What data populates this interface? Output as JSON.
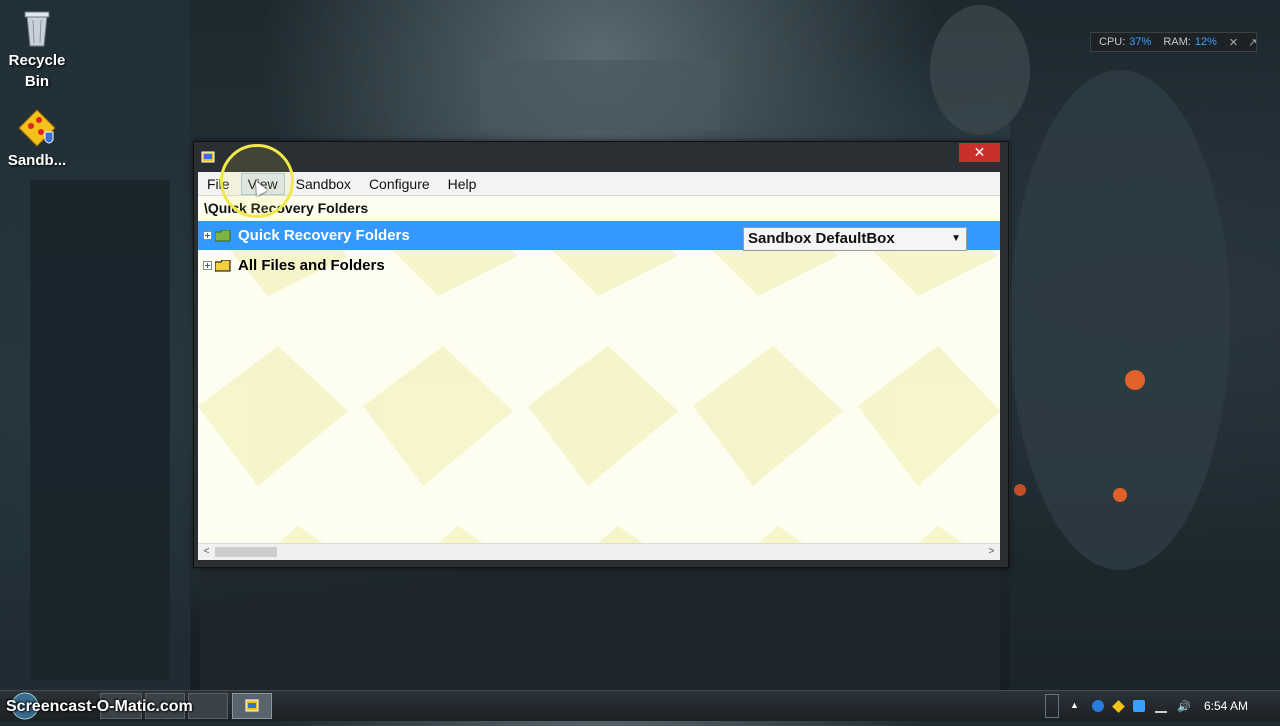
{
  "desktop": {
    "icons": [
      {
        "label": "Recycle Bin",
        "icon": "recycle-bin-icon"
      },
      {
        "label": "Sandb...",
        "icon": "sandboxie-icon"
      }
    ]
  },
  "sysmon": {
    "cpu_label": "CPU:",
    "cpu_value": "37%",
    "ram_label": "RAM:",
    "ram_value": "12%"
  },
  "window": {
    "title": "",
    "close_label": "✕",
    "menu": [
      {
        "label": "File"
      },
      {
        "label": "View"
      },
      {
        "label": "Sandbox"
      },
      {
        "label": "Configure"
      },
      {
        "label": "Help"
      }
    ],
    "path": "\\Quick Recovery Folders",
    "tree": [
      {
        "label": "Quick Recovery Folders",
        "selected": true
      },
      {
        "label": "All Files and Folders",
        "selected": false
      }
    ],
    "sandbox_select": {
      "value": "Sandbox DefaultBox",
      "options": [
        "Sandbox DefaultBox"
      ]
    },
    "scroll_left": "<",
    "scroll_right": ">"
  },
  "taskbar": {
    "watermark": "Screencast-O-Matic.com",
    "clock": "6:54 AM"
  },
  "colors": {
    "selection": "#3399ff",
    "close": "#c9302c",
    "accent": "#3aa0ff",
    "highlight_ring": "#f0e94a"
  }
}
